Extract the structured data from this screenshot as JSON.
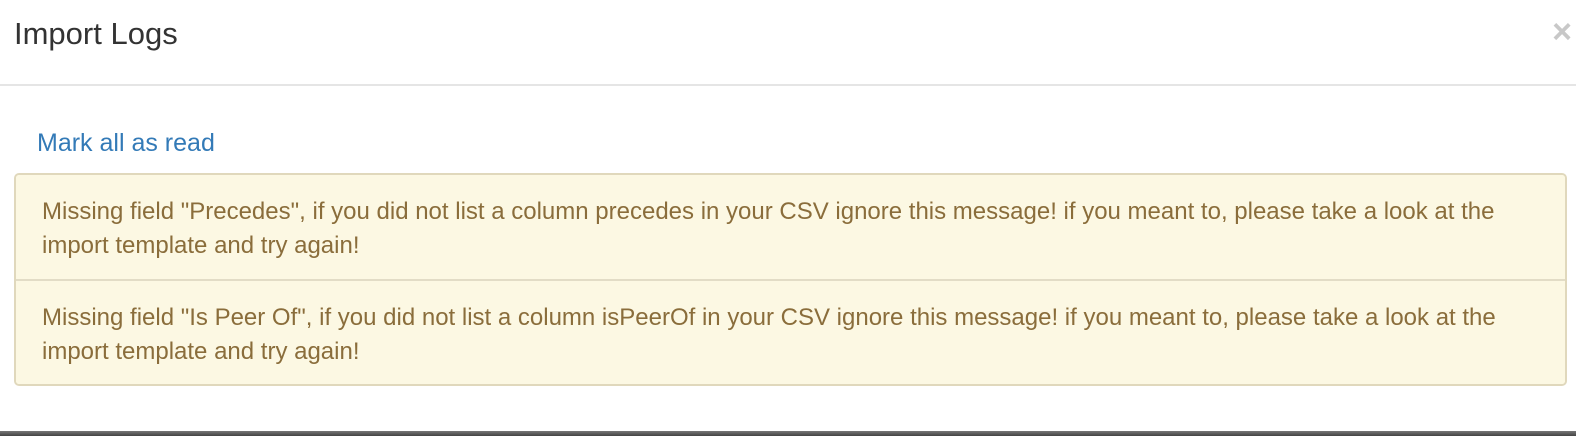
{
  "header": {
    "title": "Import Logs",
    "close_label": "×"
  },
  "body": {
    "mark_all_label": "Mark all as read",
    "logs": [
      {
        "message": "Missing field \"Precedes\", if you did not list a column precedes in your CSV ignore this message! if you meant to, please take a look at the import template and try again!"
      },
      {
        "message": "Missing field \"Is Peer Of\", if you did not list a column isPeerOf in your CSV ignore this message! if you meant to, please take a look at the import template and try again!"
      }
    ]
  },
  "colors": {
    "link": "#337ab7",
    "warning_text": "#8a6d3b",
    "warning_bg": "#fcf8e3",
    "title": "#333333"
  }
}
